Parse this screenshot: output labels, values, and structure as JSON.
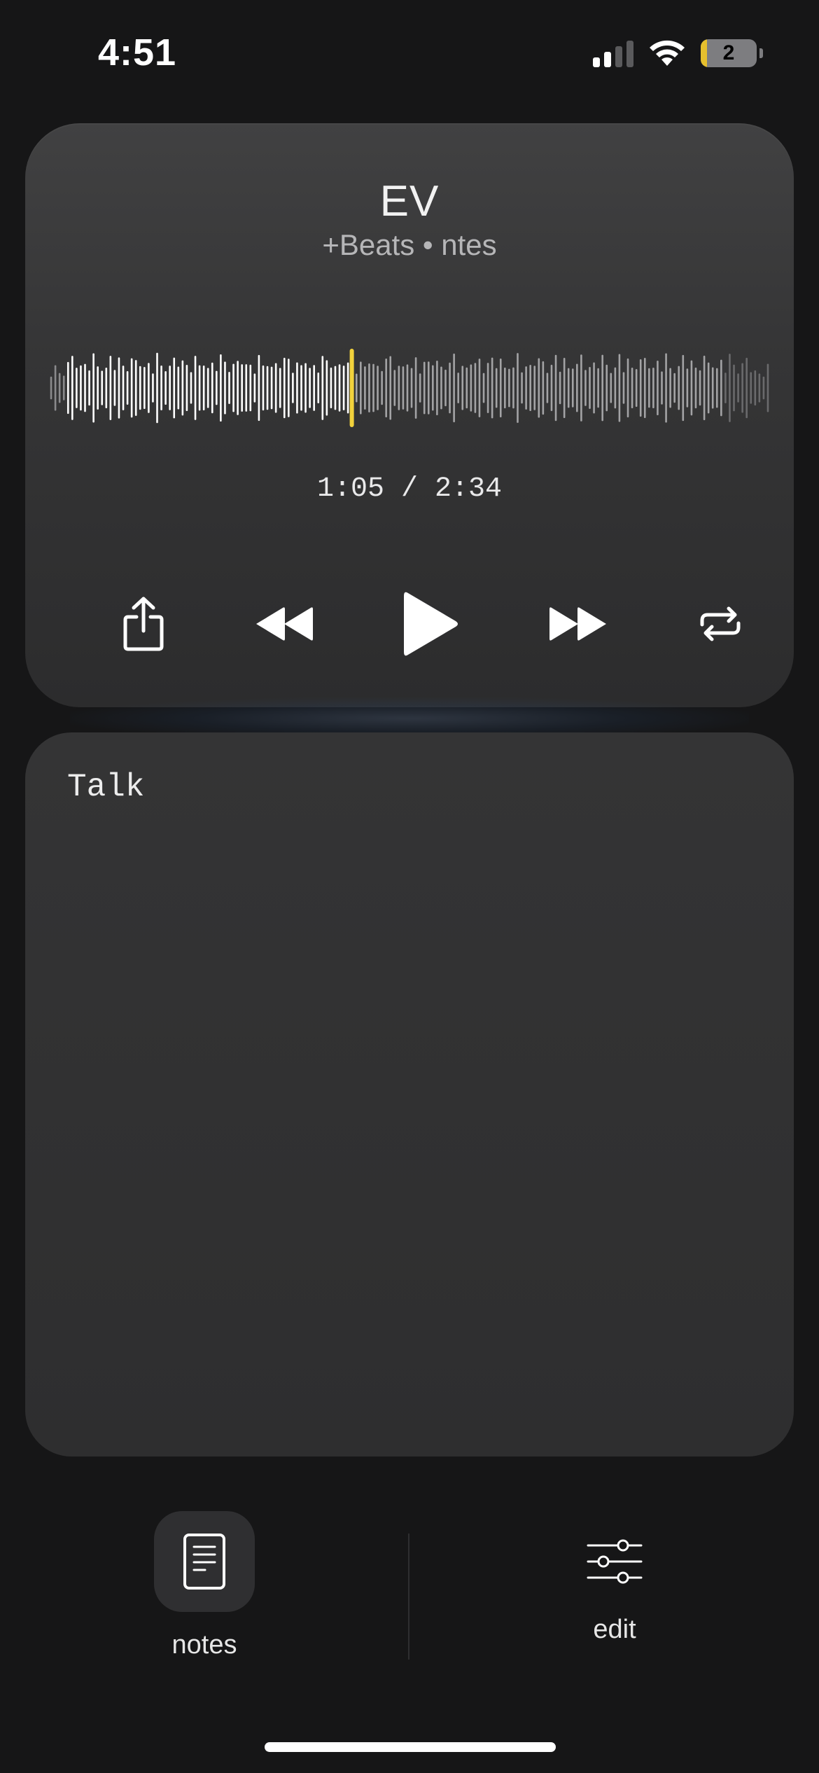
{
  "status_bar": {
    "time": "4:51",
    "signal_bars_active": 2,
    "signal_bars_total": 4,
    "wifi_icon": "wifi-icon",
    "battery_level": "2",
    "battery_color": "#e6c02e"
  },
  "player": {
    "title": "EV",
    "subtitle": "+Beats • ntes",
    "progress_fraction": 0.42,
    "time_display": "1:05 / 2:34",
    "playhead_color": "#f2d23c",
    "controls": {
      "share": "share-icon",
      "rewind": "rewind-icon",
      "play": "play-icon",
      "forward": "fast-forward-icon",
      "repeat": "repeat-icon"
    }
  },
  "notes": {
    "text": "Talk"
  },
  "nav": {
    "notes_label": "notes",
    "edit_label": "edit",
    "notes_icon": "document-icon",
    "edit_icon": "sliders-icon"
  }
}
